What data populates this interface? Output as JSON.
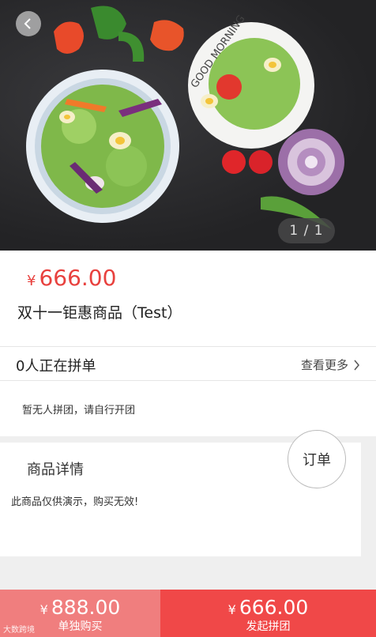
{
  "hero": {
    "pager": "1 / 1",
    "plate_text": "GOOD MORNING"
  },
  "product": {
    "currency": "¥",
    "price": "666.00",
    "title": "双十一钜惠商品（Test）"
  },
  "group": {
    "count_text": "0人正在拼单",
    "see_more": "查看更多",
    "empty_text": "暂无人拼团，请自行开团"
  },
  "details": {
    "title": "商品详情",
    "body": "此商品仅供演示，购买无效!"
  },
  "order_button": "订单",
  "bottom": {
    "single": {
      "currency": "¥",
      "price": "888.00",
      "label": "单独购买"
    },
    "group": {
      "currency": "¥",
      "price": "666.00",
      "label": "发起拼团"
    },
    "watermark": "大数跨境"
  },
  "colors": {
    "accent_red": "#e8413e",
    "single_btn": "#f07e7e",
    "group_btn": "#f04848"
  },
  "icons": {
    "back": "chevron-left-icon",
    "more": "chevron-right-icon"
  }
}
